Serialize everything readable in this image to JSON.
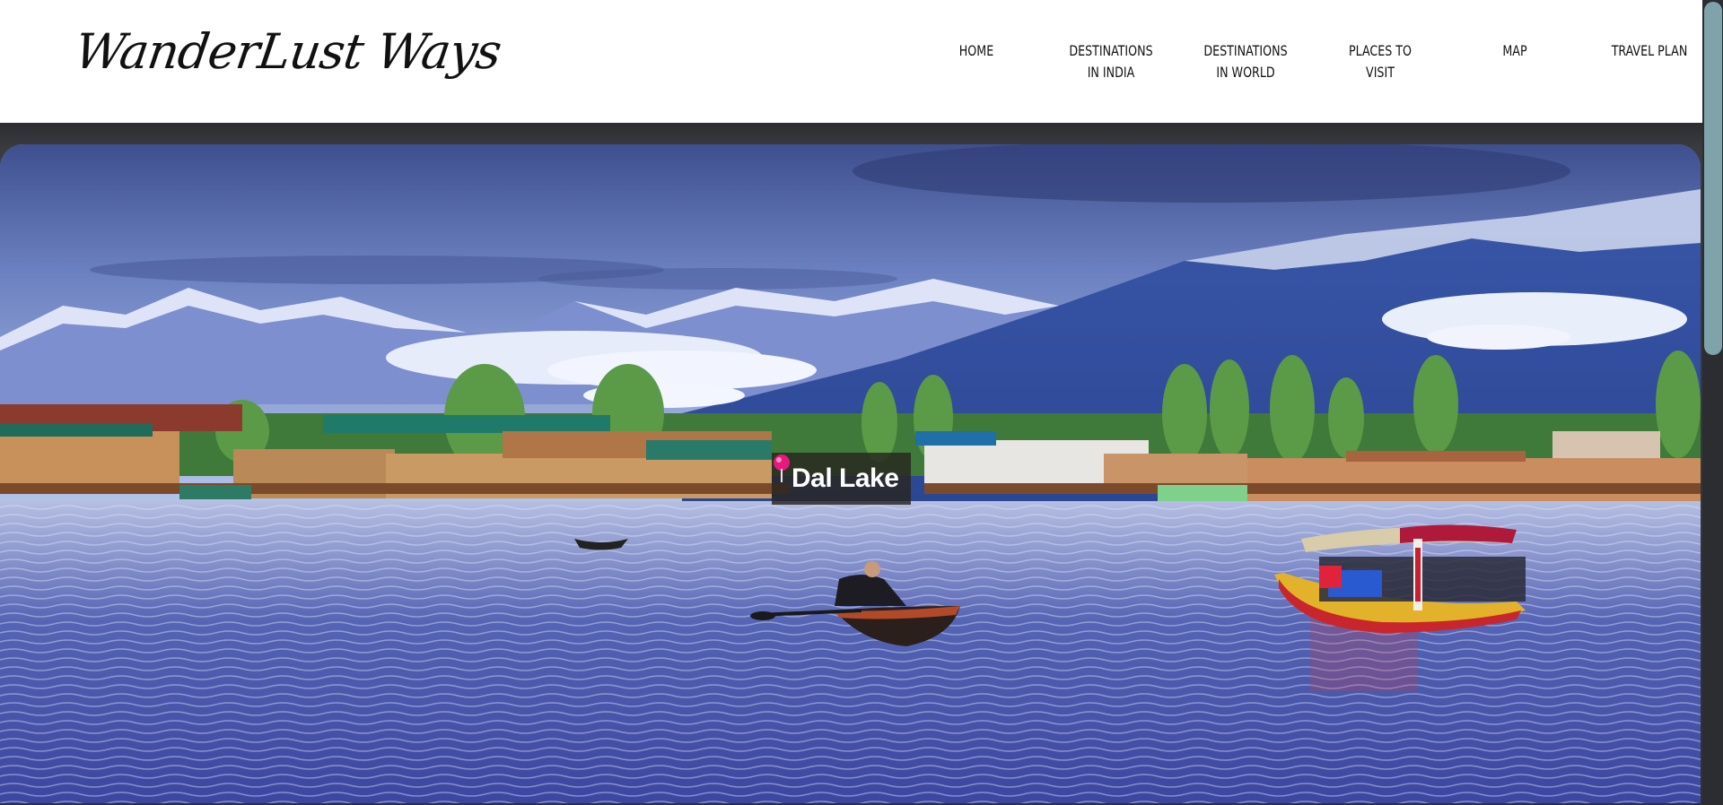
{
  "site": {
    "logo_text": "WanderLust Ways"
  },
  "nav": {
    "items": [
      {
        "label": "HOME"
      },
      {
        "label": "DESTINATIONS\nIN INDIA"
      },
      {
        "label": "DESTINATIONS\nIN WORLD"
      },
      {
        "label": "PLACES TO\nVISIT"
      },
      {
        "label": "MAP"
      },
      {
        "label": "TRAVEL PLAN"
      }
    ]
  },
  "hero": {
    "caption": "Dal Lake",
    "caption_icon": "map-pin-icon",
    "pin_color": "#e8197d"
  },
  "colors": {
    "header_bg": "#ffffff",
    "frame_bg": "#2b2d31",
    "scroll_thumb": "#7fa3aa"
  }
}
